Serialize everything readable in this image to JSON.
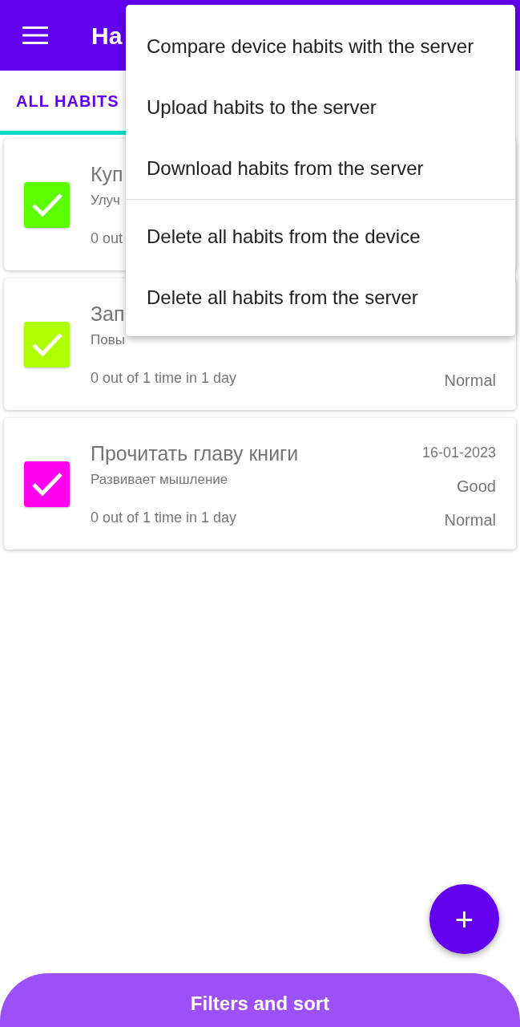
{
  "app_bar": {
    "title": "Ha"
  },
  "tabs": [
    {
      "label": "ALL HABITS",
      "selected": true
    }
  ],
  "habits": [
    {
      "name": "Куп",
      "description": "Улуч",
      "progress": "0 out",
      "checked": true,
      "color": "#5cff00"
    },
    {
      "name": "Зап",
      "description": "Повы",
      "progress": "0 out of 1 time in 1 day",
      "priority": "Normal",
      "checked": true,
      "color": "#aeff00"
    },
    {
      "name": "Прочитать главу книги",
      "description": "Развивает мышление",
      "progress": "0 out of 1 time in 1 day",
      "date": "16-01-2023",
      "type": "Good",
      "priority": "Normal",
      "checked": true,
      "color": "#ff00ee"
    }
  ],
  "menu": {
    "groups": [
      [
        "Compare device habits with the server",
        "Upload habits to the server",
        "Download habits from the server"
      ],
      [
        "Delete all habits from the device",
        "Delete all habits from the server"
      ]
    ]
  },
  "fab": {
    "label": "+"
  },
  "bottom_sheet": {
    "title": "Filters and sort"
  }
}
